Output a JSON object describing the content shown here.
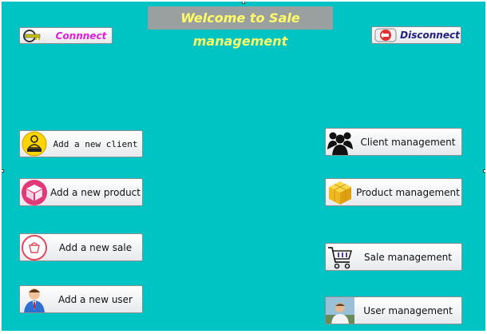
{
  "header": {
    "title": "Welcome to Sale management"
  },
  "toolbar": {
    "connect_label": "Connnect",
    "disconnect_label": "Disconnect"
  },
  "left_actions": [
    {
      "label": "Add a new client",
      "icon": "client-badge-icon"
    },
    {
      "label": "Add a new product",
      "icon": "product-box-icon"
    },
    {
      "label": "Add a new sale",
      "icon": "shopping-basket-icon"
    },
    {
      "label": "Add a new user",
      "icon": "user-add-icon"
    }
  ],
  "right_actions": [
    {
      "label": "Client management",
      "icon": "clients-group-icon"
    },
    {
      "label": "Product management",
      "icon": "product-cube-icon"
    },
    {
      "label": "Sale management",
      "icon": "shopping-cart-icon"
    },
    {
      "label": "User management",
      "icon": "user-photo-icon"
    }
  ],
  "colors": {
    "background": "#00c4c4",
    "title_bg": "#9aa0a0",
    "title_text": "#ffff66",
    "connect": "#e020e0",
    "disconnect": "#202080"
  }
}
